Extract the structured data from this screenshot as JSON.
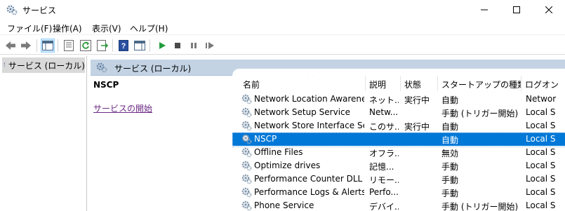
{
  "window": {
    "title": "サービス"
  },
  "menu": {
    "items": [
      {
        "label": "ファイル(F)"
      },
      {
        "label": "操作(A)"
      },
      {
        "label": "表示(V)"
      },
      {
        "label": "ヘルプ(H)"
      }
    ]
  },
  "tree": {
    "label": "サービス (ローカル)"
  },
  "header": {
    "title": "サービス (ローカル)"
  },
  "detail": {
    "name": "NSCP",
    "start_link": "サービスの開始"
  },
  "columns": [
    "名前",
    "説明",
    "状態",
    "スタートアップの種類",
    "ログオン"
  ],
  "rows": [
    {
      "name": "Network Location Awareness",
      "desc": "ネット...",
      "status": "実行中",
      "startup": "自動",
      "logon": "Networ"
    },
    {
      "name": "Network Setup Service",
      "desc": "Netw...",
      "status": "",
      "startup": "手動 (トリガー開始)",
      "logon": "Local S"
    },
    {
      "name": "Network Store Interface Ser...",
      "desc": "このサ...",
      "status": "実行中",
      "startup": "自動",
      "logon": "Local S"
    },
    {
      "name": "NSCP",
      "desc": "",
      "status": "",
      "startup": "自動",
      "logon": "Local S",
      "selected": true
    },
    {
      "name": "Offline Files",
      "desc": "オフラ...",
      "status": "",
      "startup": "無効",
      "logon": "Local S"
    },
    {
      "name": "Optimize drives",
      "desc": "記憶...",
      "status": "",
      "startup": "手動",
      "logon": "Local S"
    },
    {
      "name": "Performance Counter DLL H...",
      "desc": "リモー...",
      "status": "",
      "startup": "手動",
      "logon": "Local S"
    },
    {
      "name": "Performance Logs & Alerts",
      "desc": "Perfo...",
      "status": "",
      "startup": "手動",
      "logon": "Local S"
    },
    {
      "name": "Phone Service",
      "desc": "デバイ...",
      "status": "",
      "startup": "手動 (トリガー開始)",
      "logon": "Local S"
    }
  ],
  "colors": {
    "selection": "#0078d7",
    "header_band": "#c3d3e4",
    "link": "#6c2a84",
    "toolbar_green": "#1f9d3a"
  }
}
